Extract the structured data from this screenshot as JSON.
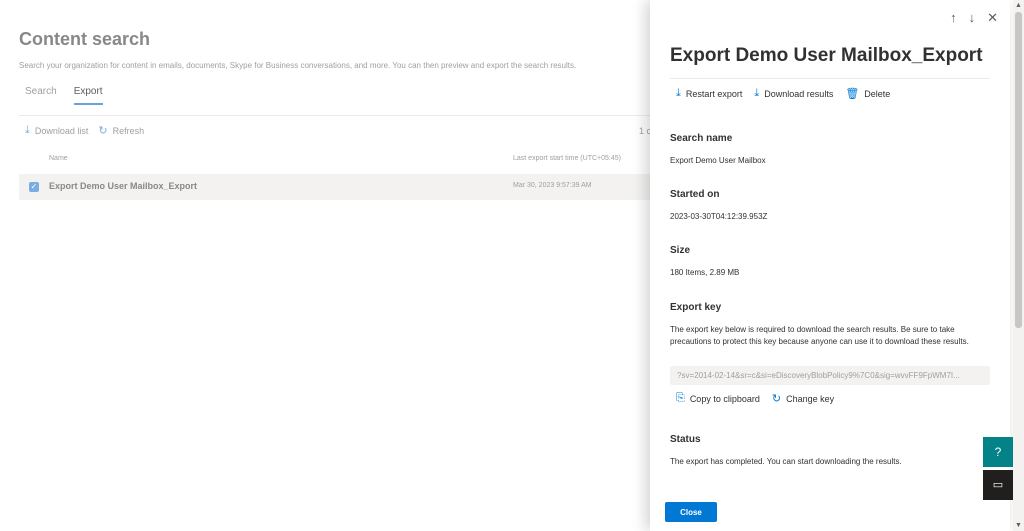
{
  "page": {
    "title": "Content search",
    "subtitle": "Search your organization for content in emails, documents, Skype for Business conversations, and more. You can then preview and export the search results.",
    "tabs": [
      {
        "label": "Search",
        "active": false
      },
      {
        "label": "Export",
        "active": true
      }
    ],
    "toolbar": {
      "download_list": "Download list",
      "refresh": "Refresh",
      "count": "1 c"
    },
    "table": {
      "columns": [
        "Name",
        "Last export start time (UTC+05:45)"
      ],
      "rows": [
        {
          "name": "Export Demo User Mailbox_Export",
          "date": "Mar 30, 2023 9:57:39 AM",
          "selected": true
        }
      ]
    }
  },
  "panel": {
    "nav": {
      "up": "↑",
      "down": "↓",
      "close": "✕"
    },
    "title": "Export Demo User Mailbox_Export",
    "actions": {
      "restart": "Restart export",
      "download": "Download results",
      "delete": "Delete"
    },
    "search_name_label": "Search name",
    "search_name_value": "Export Demo User Mailbox",
    "started_label": "Started on",
    "started_value": "2023-03-30T04:12:39.953Z",
    "size_label": "Size",
    "size_value": "180 Items, 2.89 MB",
    "export_key_label": "Export key",
    "export_key_desc": "The export key below is required to download the search results. Be sure to take precautions to protect this key because anyone can use it to download these results.",
    "export_key_value": "?sv=2014-02-14&sr=c&si=eDiscoveryBlobPolicy9%7C0&sig=wvvFF9FpWM7I...",
    "copy_label": "Copy to clipboard",
    "change_key_label": "Change key",
    "status_label": "Status",
    "status_value": "The export has completed. You can start downloading the results.",
    "close_label": "Close"
  },
  "colors": {
    "accent": "#0078d4",
    "teal_fab": "#038387",
    "dark_fab": "#201f1e"
  }
}
